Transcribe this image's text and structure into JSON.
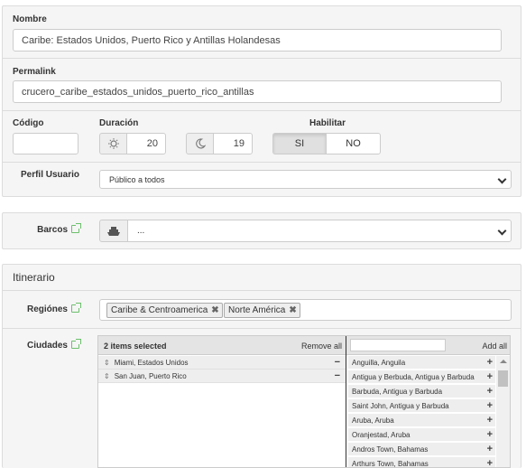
{
  "nombre": {
    "label": "Nombre",
    "value": "Caribe: Estados Unidos, Puerto Rico y Antillas Holandesas"
  },
  "permalink": {
    "label": "Permalink",
    "value": "crucero_caribe_estados_unidos_puerto_rico_antillas"
  },
  "codigo": {
    "label": "Código",
    "value": ""
  },
  "duracion": {
    "label": "Duración",
    "days": "20",
    "nights": "19"
  },
  "habilitar": {
    "label": "Habilitar",
    "si": "SI",
    "no": "NO",
    "selected": "SI"
  },
  "perfil": {
    "label": "Perfil Usuario",
    "value": "Público a todos"
  },
  "barcos": {
    "label": "Barcos",
    "value": "..."
  },
  "itinerario": {
    "title": "Itinerario",
    "regiones": {
      "label": "Regiónes",
      "tags": [
        "Caribe & Centroamerica",
        "Norte América"
      ]
    },
    "ciudades": {
      "label": "Ciudades",
      "selected_count": "2 items selected",
      "remove_all": "Remove all",
      "add_all": "Add all",
      "search_value": "",
      "selected": [
        "Miami, Estados Unidos",
        "San Juan, Puerto Rico"
      ],
      "available": [
        "Anguilla, Anguila",
        "Antigua y Berbuda, Antigua y Barbuda",
        "Barbuda, Antigua y Barbuda",
        "Saint John, Antigua y Barbuda",
        "Aruba, Aruba",
        "Oranjestad, Aruba",
        "Andros Town, Bahamas",
        "Arthurs Town, Bahamas"
      ]
    }
  },
  "colors": {
    "panel_bg": "#f5f5f5",
    "toggle_active": "#e0e0e0",
    "link_icon": "#6cbf6c"
  }
}
